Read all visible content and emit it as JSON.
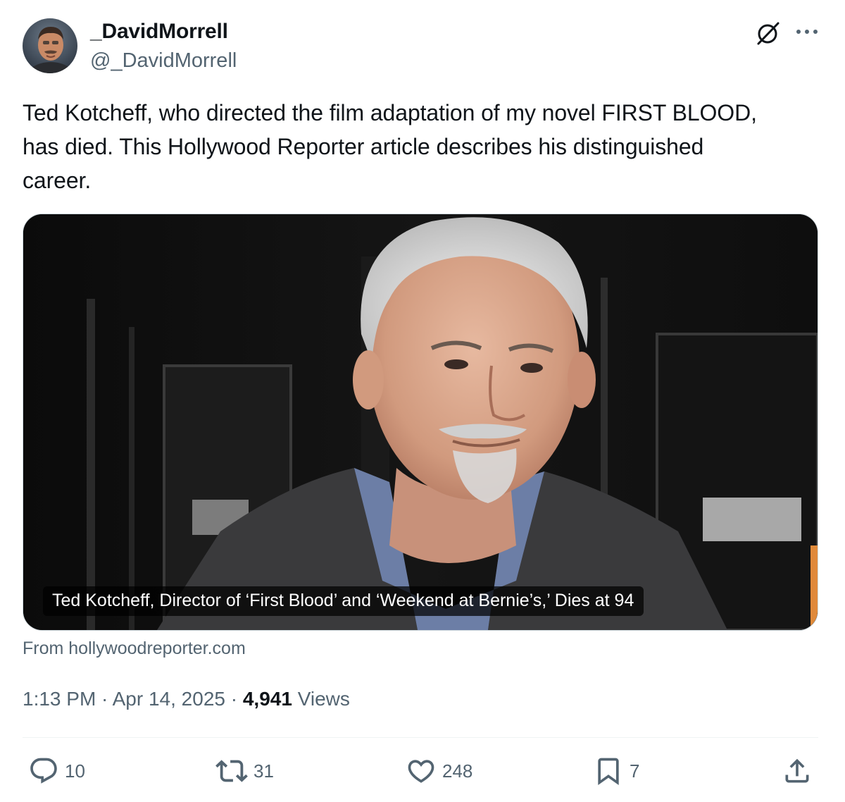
{
  "author": {
    "display_name": "_DavidMorrell",
    "handle": "@_DavidMorrell"
  },
  "header_icons": [
    "grok-icon",
    "more-icon"
  ],
  "tweet": {
    "text": "Ted Kotcheff, who directed the film adaptation of my novel FIRST BLOOD, has died. This Hollywood Reporter article describes his distinguished career."
  },
  "card": {
    "caption": "Ted Kotcheff, Director of ‘First Blood’ and ‘Weekend at Bernie’s,’ Dies at 94",
    "source": "From hollywoodreporter.com",
    "image_icon": "portrait-photo"
  },
  "meta": {
    "time": "1:13 PM",
    "separator": " · ",
    "date": "Apr 14, 2025",
    "views_count": "4,941",
    "views_label": " Views"
  },
  "actions": {
    "replies": {
      "icon": "reply-icon",
      "count": "10"
    },
    "reposts": {
      "icon": "repost-icon",
      "count": "31"
    },
    "likes": {
      "icon": "like-icon",
      "count": "248"
    },
    "bookmarks": {
      "icon": "bookmark-icon",
      "count": "7"
    },
    "share": {
      "icon": "share-icon"
    }
  },
  "colors": {
    "primary_text": "#0f1419",
    "secondary_text": "#536471",
    "border": "#cfd9de",
    "divider": "#eff3f4"
  }
}
